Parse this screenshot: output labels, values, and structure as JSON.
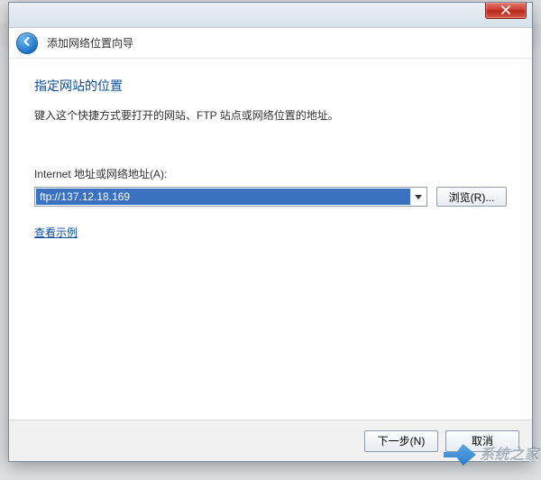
{
  "window": {
    "wizard_title": "添加网络位置向导"
  },
  "content": {
    "heading": "指定网站的位置",
    "description": "键入这个快捷方式要打开的网站、FTP 站点或网络位置的地址。",
    "address_label": "Internet 地址或网络地址(A):",
    "address_value": "ftp://137.12.18.169",
    "browse_label": "浏览(R)...",
    "example_link": "查看示例"
  },
  "footer": {
    "next_label": "下一步(N)",
    "cancel_label": "取消"
  },
  "watermark": {
    "text": "系统之家"
  }
}
